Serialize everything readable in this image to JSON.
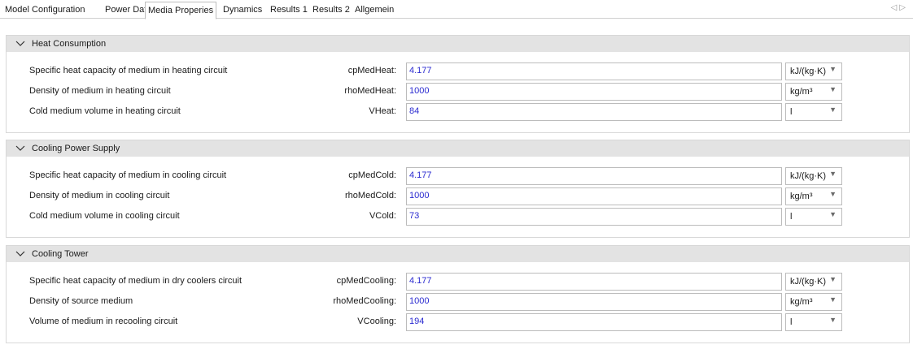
{
  "tabs": [
    {
      "label": "Model Configuration",
      "active": false
    },
    {
      "label": "Power Data",
      "active": false
    },
    {
      "label": "Media Properies",
      "active": true
    },
    {
      "label": "Dynamics",
      "active": false
    },
    {
      "label": "Results 1",
      "active": false
    },
    {
      "label": "Results 2",
      "active": false
    },
    {
      "label": "Allgemein",
      "active": false
    }
  ],
  "tab_nav": {
    "prev_icon": "chevron-left-icon",
    "next_icon": "chevron-right-icon"
  },
  "sections": [
    {
      "title": "Heat Consumption",
      "rows": [
        {
          "description": "Specific heat capacity of medium in heating circuit",
          "variable": "cpMedHeat:",
          "value": "4.177",
          "unit": "kJ/(kg·K)"
        },
        {
          "description": "Density of medium in heating circuit",
          "variable": "rhoMedHeat:",
          "value": "1000",
          "unit": "kg/m³"
        },
        {
          "description": "Cold medium volume in heating circuit",
          "variable": "VHeat:",
          "value": "84",
          "unit": "l"
        }
      ]
    },
    {
      "title": "Cooling Power Supply",
      "rows": [
        {
          "description": "Specific heat capacity of medium in cooling circuit",
          "variable": "cpMedCold:",
          "value": "4.177",
          "unit": "kJ/(kg·K)"
        },
        {
          "description": "Density of medium in cooling circuit",
          "variable": "rhoMedCold:",
          "value": "1000",
          "unit": "kg/m³"
        },
        {
          "description": "Cold medium volume in cooling circuit",
          "variable": "VCold:",
          "value": "73",
          "unit": "l"
        }
      ]
    },
    {
      "title": "Cooling Tower",
      "rows": [
        {
          "description": "Specific heat capacity of medium in dry coolers circuit",
          "variable": "cpMedCooling:",
          "value": "4.177",
          "unit": "kJ/(kg·K)"
        },
        {
          "description": "Density of source medium",
          "variable": "rhoMedCooling:",
          "value": "1000",
          "unit": "kg/m³"
        },
        {
          "description": "Volume of medium in recooling circuit",
          "variable": "VCooling:",
          "value": "194",
          "unit": "l"
        }
      ]
    }
  ],
  "colors": {
    "value_text": "#2a2ad0",
    "header_bg": "#e3e3e3"
  }
}
